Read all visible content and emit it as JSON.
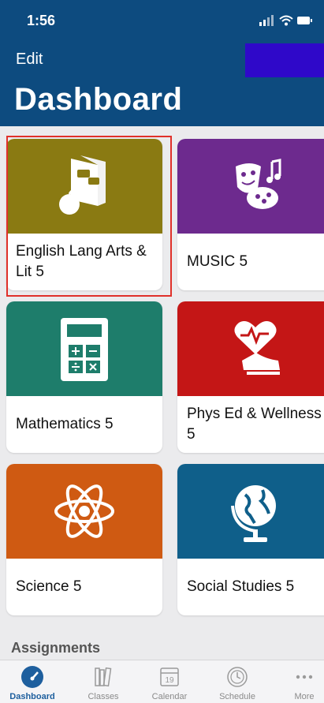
{
  "status": {
    "time": "1:56"
  },
  "header": {
    "edit_label": "Edit",
    "title": "Dashboard"
  },
  "cards": [
    {
      "label": "English Lang Arts & Lit 5",
      "color": "#8a7a12",
      "icon": "books-apple-icon",
      "selected": true
    },
    {
      "label": "MUSIC 5",
      "color": "#6d2a8e",
      "icon": "theater-masks-icon",
      "selected": false
    },
    {
      "label": "Mathematics 5",
      "color": "#1e7d6b",
      "icon": "calculator-icon",
      "selected": false
    },
    {
      "label": "Phys Ed & Wellness 5",
      "color": "#c41616",
      "icon": "heart-sneaker-icon",
      "selected": false
    },
    {
      "label": "Science 5",
      "color": "#cf5a12",
      "icon": "atom-icon",
      "selected": false
    },
    {
      "label": "Social Studies 5",
      "color": "#0f5f8a",
      "icon": "globe-icon",
      "selected": false
    }
  ],
  "sections": {
    "assignments_title": "Assignments"
  },
  "tabbar": {
    "tabs": [
      {
        "label": "Dashboard",
        "icon": "dashboard-gauge-icon",
        "active": true
      },
      {
        "label": "Classes",
        "icon": "books-icon",
        "active": false
      },
      {
        "label": "Calendar",
        "icon": "calendar-icon",
        "active": false,
        "day": "19"
      },
      {
        "label": "Schedule",
        "icon": "clock-icon",
        "active": false
      },
      {
        "label": "More",
        "icon": "more-dots-icon",
        "active": false
      }
    ]
  }
}
